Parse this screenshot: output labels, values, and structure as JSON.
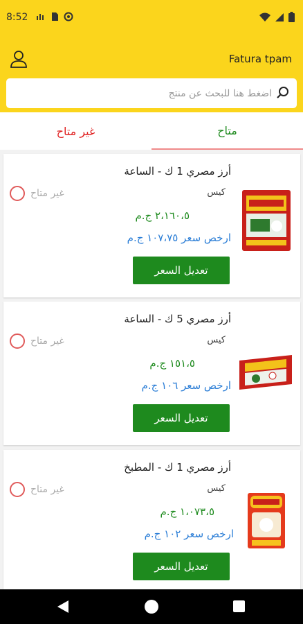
{
  "status_bar": {
    "time": "8:52"
  },
  "header": {
    "app_title": "Fatura tpam"
  },
  "search": {
    "placeholder": "اضغط هنا للبحث عن منتج"
  },
  "tabs": [
    {
      "label": "متاح",
      "active": true
    },
    {
      "label": "غير متاح",
      "active": false
    }
  ],
  "products": [
    {
      "title": "أرز مصري 1 ك - الساعة",
      "unit": "كيس",
      "price": "٢،١٦٠،٥ ج.م",
      "cheapest": "ارخص سعر ١٠٧،٧٥ ج.م",
      "button": "تعديل السعر",
      "unavailable_label": "غير متاح"
    },
    {
      "title": "أرز مصري 5 ك - الساعة",
      "unit": "كيس",
      "price": "١٥١،٥ ج.م",
      "cheapest": "ارخص سعر ١٠٦ ج.م",
      "button": "تعديل السعر",
      "unavailable_label": "غير متاح"
    },
    {
      "title": "أرز مصري 1 ك - المطبخ",
      "unit": "كيس",
      "price": "١،٠٧٣،٥ ج.م",
      "cheapest": "ارخص سعر ١٠٢ ج.م",
      "button": "تعديل السعر",
      "unavailable_label": "غير متاح"
    }
  ],
  "colors": {
    "header_yellow": "#fbd51c",
    "available_green": "#1d8a1d",
    "unavailable_red": "#e02020",
    "cheapest_blue": "#2a7dd6"
  }
}
